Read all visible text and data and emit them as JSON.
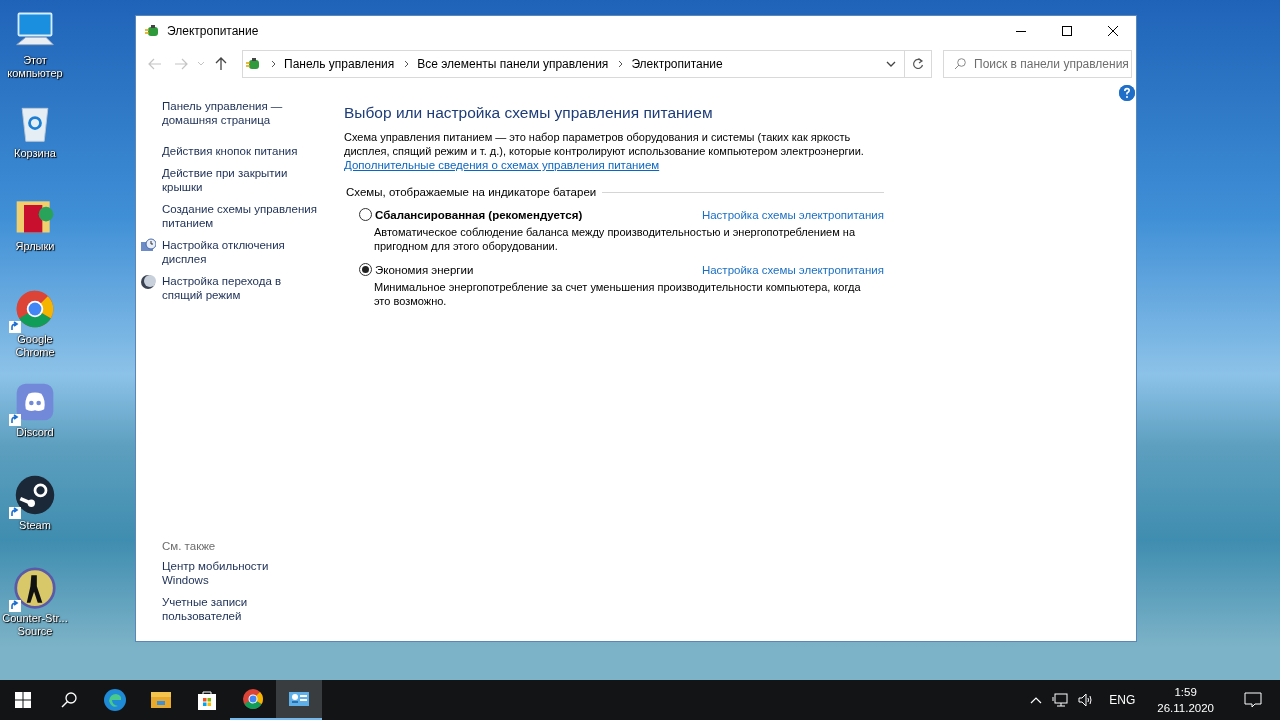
{
  "desktop_icons": [
    {
      "label": "Этот компьютер",
      "kind": "computer",
      "shortcut": false
    },
    {
      "label": "Корзина",
      "kind": "recycle",
      "shortcut": false
    },
    {
      "label": "Ярлыки",
      "kind": "folder",
      "shortcut": false
    },
    {
      "label": "Google Chrome",
      "kind": "chrome",
      "shortcut": true
    },
    {
      "label": "Discord",
      "kind": "discord",
      "shortcut": true
    },
    {
      "label": "Steam",
      "kind": "steam",
      "shortcut": true
    },
    {
      "label": "Counter-Str... Source",
      "kind": "game",
      "shortcut": true
    }
  ],
  "window": {
    "title": "Электропитание",
    "breadcrumb": [
      "Панель управления",
      "Все элементы панели управления",
      "Электропитание"
    ],
    "search": {
      "placeholder": "Поиск в панели управления"
    },
    "sidebar": {
      "items": [
        {
          "label": "Панель управления — домашняя страница",
          "kind": "home"
        },
        {
          "label": "Действия кнопок питания",
          "kind": "link"
        },
        {
          "label": "Действие при закрытии крышки",
          "kind": "link"
        },
        {
          "label": "Создание схемы управления питанием",
          "kind": "link"
        },
        {
          "label": "Настройка отключения дисплея",
          "kind": "display"
        },
        {
          "label": "Настройка перехода в спящий режим",
          "kind": "sleep"
        }
      ],
      "see_also_title": "См. также",
      "see_also": [
        "Центр мобильности Windows",
        "Учетные записи пользователей"
      ]
    },
    "content": {
      "heading": "Выбор или настройка схемы управления питанием",
      "description": "Схема управления питанием — это набор параметров оборудования и системы (таких как яркость дисплея, спящий режим и т. д.), которые контролируют использование компьютером электроэнергии.",
      "link": "Дополнительные сведения о схемах управления питанием",
      "group_title": "Схемы, отображаемые на индикаторе батареи",
      "plans": [
        {
          "name": "Сбалансированная (рекомендуется)",
          "recommended": true,
          "selected": false,
          "settings_link": "Настройка схемы электропитания",
          "description": "Автоматическое соблюдение баланса между производительностью и энергопотреблением на пригодном для этого оборудовании."
        },
        {
          "name": "Экономия энергии",
          "recommended": false,
          "selected": true,
          "settings_link": "Настройка схемы электропитания",
          "description": "Минимальное энергопотребление за счет уменьшения производительности компьютера, когда это возможно."
        }
      ]
    }
  },
  "taskbar": {
    "apps": [
      {
        "kind": "edge",
        "running": false,
        "active": false
      },
      {
        "kind": "explorer",
        "running": false,
        "active": false
      },
      {
        "kind": "store",
        "running": false,
        "active": false
      },
      {
        "kind": "chrome",
        "running": true,
        "active": false
      },
      {
        "kind": "control-panel",
        "running": true,
        "active": true
      }
    ],
    "language": "ENG",
    "time": "1:59",
    "date": "26.11.2020"
  }
}
